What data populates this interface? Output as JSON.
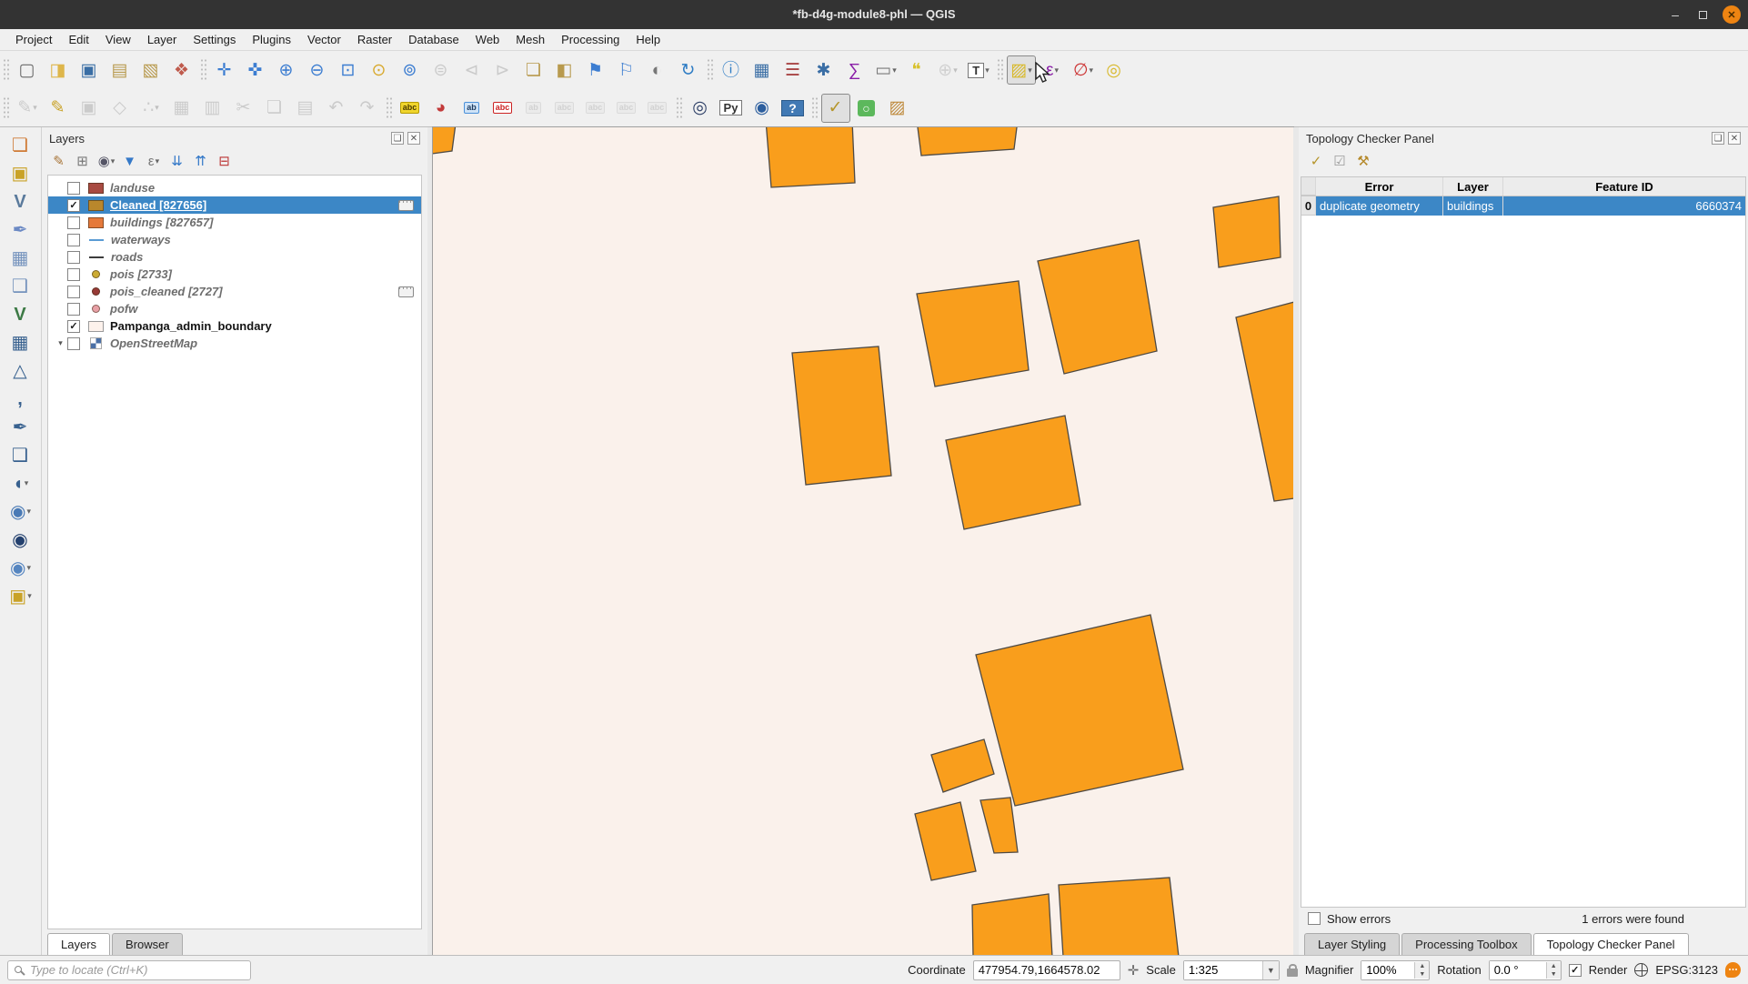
{
  "window": {
    "title": "*fb-d4g-module8-phl — QGIS",
    "controls": {
      "minimize": "–",
      "close": "✕"
    }
  },
  "menu": {
    "items": [
      "Project",
      "Edit",
      "View",
      "Layer",
      "Settings",
      "Plugins",
      "Vector",
      "Raster",
      "Database",
      "Web",
      "Mesh",
      "Processing",
      "Help"
    ]
  },
  "icons": {
    "panel_float": "❏",
    "panel_close": "✕"
  },
  "toolbar1": {
    "project": [
      {
        "n": "new-project-button",
        "g": "▢",
        "c": "#6a6a6a"
      },
      {
        "n": "open-project-button",
        "g": "◨",
        "c": "#deb64b"
      },
      {
        "n": "save-project-button",
        "g": "▣",
        "c": "#3a6ea5"
      },
      {
        "n": "new-print-layout-button",
        "g": "▤",
        "c": "#b89a4e"
      },
      {
        "n": "show-layout-manager-button",
        "g": "▧",
        "c": "#b89a4e"
      },
      {
        "n": "style-manager-button",
        "g": "❖",
        "c": "#bf5b4d"
      }
    ],
    "navigation": [
      {
        "n": "pan-map-button",
        "g": "✛",
        "c": "#3c7dd1"
      },
      {
        "n": "pan-to-selection-button",
        "g": "✜",
        "c": "#3c7dd1"
      },
      {
        "n": "zoom-in-button",
        "g": "⊕",
        "c": "#3c7dd1"
      },
      {
        "n": "zoom-out-button",
        "g": "⊖",
        "c": "#3c7dd1"
      },
      {
        "n": "zoom-full-button",
        "g": "⊡",
        "c": "#3c7dd1"
      },
      {
        "n": "zoom-to-selection-button",
        "g": "⊙",
        "c": "#d8a92c"
      },
      {
        "n": "zoom-to-layer-button",
        "g": "⊚",
        "c": "#3c7dd1"
      },
      {
        "n": "zoom-native-button",
        "g": "⊜",
        "c": "#888",
        "s": "disabled"
      },
      {
        "n": "zoom-last-button",
        "g": "⊲",
        "c": "#888",
        "s": "disabled"
      },
      {
        "n": "zoom-next-button",
        "g": "⊳",
        "c": "#888",
        "s": "disabled"
      },
      {
        "n": "new-map-view-button",
        "g": "❏",
        "c": "#b89a4e"
      },
      {
        "n": "new-3d-map-view-button",
        "g": "◧",
        "c": "#b89a4e"
      },
      {
        "n": "new-spatial-bookmark-button",
        "g": "⚑",
        "c": "#3c7dd1"
      },
      {
        "n": "show-spatial-bookmarks-button",
        "g": "⚐",
        "c": "#3c7dd1"
      },
      {
        "n": "temporal-controller-button",
        "g": "◐",
        "c": "#777777"
      },
      {
        "n": "refresh-button",
        "g": "↻",
        "c": "#2e7cc4"
      }
    ],
    "attributes": [
      {
        "n": "identify-features-button",
        "g": "ⓘ",
        "c": "#2e7cc4"
      },
      {
        "n": "open-attribute-table-button",
        "g": "▦",
        "c": "#3a6ea5"
      },
      {
        "n": "field-calculator-button",
        "g": "☰",
        "c": "#a84444"
      },
      {
        "n": "options-gear-button",
        "g": "✱",
        "c": "#3a6ea5"
      },
      {
        "n": "statistics-button",
        "g": "∑",
        "c": "#8a1fa8"
      },
      {
        "n": "measure-button",
        "g": "▭",
        "c": "#7a7a7a",
        "dd": "▾"
      },
      {
        "n": "map-tips-button",
        "g": "❝",
        "c": "#d8c12c"
      },
      {
        "n": "search-button",
        "g": "⊕",
        "c": "#999999",
        "s": "disabled",
        "dd": "▾"
      },
      {
        "n": "text-annotation-button",
        "g": "T",
        "k": "boxed",
        "dd": "▾"
      }
    ],
    "selection": [
      {
        "n": "select-features-button",
        "g": "▨",
        "c": "#d8b92c",
        "s": "pressed",
        "dd": "▾"
      },
      {
        "n": "select-by-expression-button",
        "g": "ε",
        "c": "#8a1fa8",
        "dd": "▾"
      },
      {
        "n": "deselect-all-button",
        "g": "∅",
        "c": "#cc3333",
        "dd": "▾"
      },
      {
        "n": "select-by-location-button",
        "g": "◎",
        "c": "#d8b92c"
      }
    ]
  },
  "toolbar2": {
    "digitizing": [
      {
        "n": "current-edits-button",
        "g": "✎",
        "c": "#888",
        "s": "disabled",
        "dd": "▾"
      },
      {
        "n": "toggle-editing-button",
        "g": "✎",
        "c": "#c9a227"
      },
      {
        "n": "save-layer-edits-button",
        "g": "▣",
        "c": "#888",
        "s": "disabled"
      },
      {
        "n": "add-polygon-feature-button",
        "g": "◇",
        "c": "#888",
        "s": "disabled"
      },
      {
        "n": "vertex-tool-button",
        "g": "∴",
        "c": "#888",
        "s": "disabled",
        "dd": "▾"
      },
      {
        "n": "modify-attributes-button",
        "g": "▦",
        "c": "#888",
        "s": "disabled"
      },
      {
        "n": "delete-selected-button",
        "g": "▥",
        "c": "#888",
        "s": "disabled"
      },
      {
        "n": "cut-features-button",
        "g": "✂",
        "c": "#888",
        "s": "disabled"
      },
      {
        "n": "copy-features-button",
        "g": "❏",
        "c": "#888",
        "s": "disabled"
      },
      {
        "n": "paste-features-button",
        "g": "▤",
        "c": "#888",
        "s": "disabled"
      },
      {
        "n": "undo-button",
        "g": "↶",
        "c": "#888",
        "s": "disabled"
      },
      {
        "n": "redo-button",
        "g": "↷",
        "c": "#888",
        "s": "disabled"
      }
    ],
    "labels": [
      {
        "n": "layer-labeling-button",
        "g": "abc",
        "k": "tag tag-yellow"
      },
      {
        "n": "layer-diagram-button",
        "g": "◕",
        "c": "#c23a3a"
      },
      {
        "n": "pin-labels-button",
        "g": "ab",
        "k": "tag tag-blue"
      },
      {
        "n": "highlight-labels-button",
        "g": "abc",
        "k": "tag tag-red"
      },
      {
        "n": "pin-unpin-labels-button",
        "g": "ab",
        "k": "tag tag-gray",
        "s": "disabled"
      },
      {
        "n": "show-hidden-labels-button",
        "g": "abc",
        "k": "tag tag-gray",
        "s": "disabled"
      },
      {
        "n": "move-label-button",
        "g": "abc",
        "k": "tag tag-gray",
        "s": "disabled"
      },
      {
        "n": "rotate-label-button",
        "g": "abc",
        "k": "tag tag-gray",
        "s": "disabled"
      },
      {
        "n": "change-label-button",
        "g": "abc",
        "k": "tag tag-gray",
        "s": "disabled"
      }
    ],
    "plugins": [
      {
        "n": "metasearch-button",
        "g": "◎",
        "c": "#2c3e66"
      },
      {
        "n": "python-console-button",
        "g": "Py",
        "k": "boxed"
      },
      {
        "n": "web-browser-button",
        "g": "◉",
        "c": "#2c5e9e"
      },
      {
        "n": "help-contents-button",
        "g": "?",
        "k": "boxed-blue"
      }
    ],
    "topology": [
      {
        "n": "topology-checker-button",
        "g": "✓",
        "c": "#b5952a",
        "s": "pressed"
      },
      {
        "n": "geosearch-plugin-button",
        "g": "○",
        "k": "boxed-green"
      },
      {
        "n": "osm-tools-button",
        "g": "▨",
        "c": "#bf8b3e"
      }
    ]
  },
  "left_toolbar": [
    {
      "n": "data-source-manager-button",
      "g": "❏",
      "c": "#cf7a35"
    },
    {
      "n": "new-geopackage-layer-button",
      "g": "▣",
      "c": "#c9a227"
    },
    {
      "n": "new-shapefile-layer-button",
      "g": "V",
      "c": "#5a7a9c",
      "k": "bold"
    },
    {
      "n": "new-spatialite-layer-button",
      "g": "✒",
      "c": "#6b89c4"
    },
    {
      "n": "new-memory-layer-button",
      "g": "▦",
      "c": "#7593bd"
    },
    {
      "n": "new-virtual-layer-button",
      "g": "❑",
      "c": "#7593bd"
    },
    {
      "n": "add-vector-layer-button",
      "g": "V",
      "c": "#3d7a46",
      "k": "bold"
    },
    {
      "n": "add-raster-layer-button",
      "g": "▦",
      "c": "#38618f"
    },
    {
      "n": "add-mesh-layer-button",
      "g": "△",
      "c": "#38618f"
    },
    {
      "n": "add-delimited-text-layer-button",
      "g": ",",
      "c": "#38618f",
      "k": "bold"
    },
    {
      "n": "add-spatialite-layer-button",
      "g": "✒",
      "c": "#38618f"
    },
    {
      "n": "add-virtual-layer-button",
      "g": "❑",
      "c": "#38618f"
    },
    {
      "n": "add-postgis-layer-button",
      "g": "◖",
      "c": "#38618f",
      "dd": "▾"
    },
    {
      "n": "add-wms-layer-button",
      "g": "◉",
      "c": "#4a7ab5",
      "dd": "▾"
    },
    {
      "n": "add-xyz-layer-button",
      "g": "◉",
      "c": "#23406e"
    },
    {
      "n": "add-wfs-layer-button",
      "g": "◉",
      "c": "#5585c0",
      "dd": "▾"
    },
    {
      "n": "add-web-layer-button",
      "g": "▣",
      "c": "#c9a227",
      "dd": "▾"
    }
  ],
  "layers_panel": {
    "title": "Layers",
    "toolbar": [
      {
        "n": "open-layer-styling-dock-button",
        "g": "✎",
        "c": "#a8763a"
      },
      {
        "n": "add-group-button",
        "g": "⊞",
        "c": "#777777"
      },
      {
        "n": "manage-map-themes-button",
        "g": "◉",
        "c": "#556",
        "dd": "▾"
      },
      {
        "n": "filter-legend-button",
        "g": "▼",
        "c": "#3579c8"
      },
      {
        "n": "filter-legend-by-expression-button",
        "g": "ε",
        "c": "#777",
        "dd": "▾"
      },
      {
        "n": "expand-all-button",
        "g": "⇊",
        "c": "#3579c8"
      },
      {
        "n": "collapse-all-button",
        "g": "⇈",
        "c": "#3579c8"
      },
      {
        "n": "remove-layer-button",
        "g": "⊟",
        "c": "#bb3333"
      }
    ],
    "items": [
      {
        "label": "landuse",
        "checked": "",
        "row": "",
        "text": "t-gray",
        "sw": "sw-fill",
        "color": "#a84a41",
        "ind": "",
        "exp": ""
      },
      {
        "label": "Cleaned [827656]",
        "checked": "on",
        "row": "selected",
        "text": "t-sel",
        "sw": "sw-fill",
        "color": "#b9872c",
        "ind": "chip",
        "exp": ""
      },
      {
        "label": "buildings [827657]",
        "checked": "",
        "row": "",
        "text": "t-gray",
        "sw": "sw-fill",
        "color": "#e5793a",
        "ind": "",
        "exp": ""
      },
      {
        "label": "waterways",
        "checked": "",
        "row": "",
        "text": "t-gray",
        "sw": "sw-line",
        "color": "#5a9bd4",
        "ind": "",
        "exp": ""
      },
      {
        "label": "roads",
        "checked": "",
        "row": "",
        "text": "t-gray",
        "sw": "sw-line",
        "color": "#3c3c3c",
        "ind": "",
        "exp": ""
      },
      {
        "label": "pois [2733]",
        "checked": "",
        "row": "",
        "text": "t-gray",
        "sw": "sw-point",
        "color": "#ccab33",
        "ind": "",
        "exp": ""
      },
      {
        "label": "pois_cleaned [2727]",
        "checked": "",
        "row": "",
        "text": "t-gray",
        "sw": "sw-point",
        "color": "#973a36",
        "ind": "chip",
        "exp": ""
      },
      {
        "label": "pofw",
        "checked": "",
        "row": "",
        "text": "t-gray",
        "sw": "sw-point",
        "color": "#e8a0a6",
        "ind": "",
        "exp": ""
      },
      {
        "label": "Pampanga_admin_boundary",
        "checked": "on",
        "row": "",
        "text": "t-black",
        "sw": "sw-frame",
        "color": "#fdf2ec",
        "ind": "",
        "exp": ""
      },
      {
        "label": "OpenStreetMap",
        "checked": "",
        "row": "",
        "text": "t-gray",
        "sw": "sw-checker",
        "color": "#5b7fb4",
        "ind": "",
        "exp": "▾"
      }
    ],
    "tabs": [
      {
        "label": "Layers",
        "cls": "active"
      },
      {
        "label": "Browser",
        "cls": ""
      }
    ]
  },
  "map": {
    "background": "#faf1eb",
    "fill": "#f99e1c",
    "stroke": "#4e4a44",
    "polygons": [
      "-8,-6 25,-4 21,26 -8,30",
      "366,-8 461,-8 464,61 372,66",
      "532,-8 643,-8 639,24 537,31",
      "858,88 930,76 932,143 864,154",
      "665,147 776,124 796,246 694,271",
      "532,183 644,169 655,267 552,285",
      "395,248 490,241 504,383 410,393",
      "564,344 695,317 712,415 584,442",
      "883,209 947,192 947,408 925,411",
      "597,580 789,536 825,706 640,746",
      "548,690 606,673 617,711 561,731",
      "530,755 580,742 597,818 548,828",
      "602,740 635,737 643,797 617,798",
      "593,855 677,843 681,912 594,912",
      "688,833 810,825 820,912 693,912"
    ]
  },
  "topology_panel": {
    "title": "Topology Checker Panel",
    "toolbar": [
      {
        "n": "validate-all-button",
        "g": "✓",
        "c": "#b5952a"
      },
      {
        "n": "validate-extent-button",
        "g": "☑",
        "c": "#9a9a9a"
      },
      {
        "n": "configure-button",
        "g": "⚒",
        "c": "#b5892a"
      }
    ],
    "table": {
      "headers": {
        "error": "Error",
        "layer": "Layer",
        "feature_id": "Feature ID"
      },
      "row": {
        "index": "0",
        "error": "duplicate geometry",
        "layer": "buildings",
        "feature_id": "6660374"
      }
    },
    "footer": {
      "show_errors": "Show errors",
      "show_errors_checked": "",
      "summary": "1 errors were found"
    },
    "tabs": [
      {
        "label": "Layer Styling",
        "cls": ""
      },
      {
        "label": "Processing Toolbox",
        "cls": ""
      },
      {
        "label": "Topology Checker Panel",
        "cls": "active"
      }
    ]
  },
  "statusbar": {
    "locate_placeholder": "Type to locate (Ctrl+K)",
    "coordinate_label": "Coordinate",
    "coordinate_value": "477954.79,1664578.02",
    "extents_icon": "✛",
    "scale_label": "Scale",
    "scale_value": "1:325",
    "magnifier_label": "Magnifier",
    "magnifier_value": "100%",
    "rotation_label": "Rotation",
    "rotation_value": "0.0 °",
    "render_label": "Render",
    "render_checked": "on",
    "crs_value": "EPSG:3123"
  }
}
